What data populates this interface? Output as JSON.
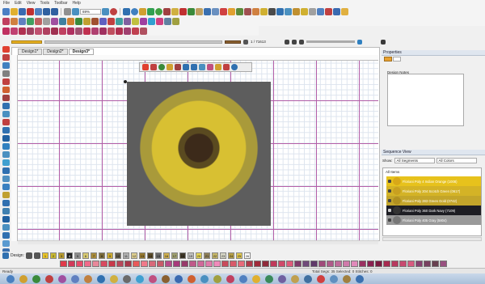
{
  "menu": [
    "File",
    "Edit",
    "View",
    "Tools",
    "Toolbar",
    "Help"
  ],
  "zoom": "69%",
  "stitch_position": "1 / 71613",
  "tabs": [
    "Design1*",
    "Design2*",
    "Design3*"
  ],
  "properties": {
    "title": "Properties",
    "notes_label": "Design Notes"
  },
  "sequence": {
    "title": "Sequence View",
    "show_label": "Show:",
    "segments": "All Segments",
    "colors": "All Colors",
    "all_items": "All Items",
    "items": [
      {
        "label": "Floriani Poly 4 Indian Orange (1008)",
        "color": "#e7c21c"
      },
      {
        "label": "Floriani Poly 204 Scotch Green (0617)",
        "color": "#d4b326"
      },
      {
        "label": "Floriani Poly 283 Green Gold (0742)",
        "color": "#c3a52a"
      },
      {
        "label": "Floriani Poly 360 Dark Navy (7109)",
        "color": "#1d1d23"
      },
      {
        "label": "Floriani Poly 405 Gray (5804)",
        "color": "#9a9a9a"
      }
    ]
  },
  "design_label": "Design:",
  "thread_swatches": [
    {
      "n": "1",
      "c": "#e8c328"
    },
    {
      "n": "2",
      "c": "#c8b832"
    },
    {
      "n": "3",
      "c": "#b89b2e"
    },
    {
      "n": "4",
      "c": "#222222"
    },
    {
      "n": "5",
      "c": "#8c8c8c"
    },
    {
      "n": "6",
      "c": "#d8ca72"
    },
    {
      "n": "7",
      "c": "#a88a3a"
    },
    {
      "n": "8",
      "c": "#7a6a3a"
    },
    {
      "n": "9",
      "c": "#c8a830"
    },
    {
      "n": "10",
      "c": "#605a4a"
    },
    {
      "n": "11",
      "c": "#b0b0b0"
    },
    {
      "n": "12",
      "c": "#e0d090"
    },
    {
      "n": "13",
      "c": "#987a30"
    },
    {
      "n": "14",
      "c": "#5a4a28"
    },
    {
      "n": "15",
      "c": "#6a6a6a"
    },
    {
      "n": "16",
      "c": "#d0b050"
    },
    {
      "n": "17",
      "c": "#a0a070"
    },
    {
      "n": "18",
      "c": "#403828"
    },
    {
      "n": "19",
      "c": "#c0c0c0"
    },
    {
      "n": "20",
      "c": "#e8d858"
    },
    {
      "n": "21",
      "c": "#908058"
    },
    {
      "n": "22",
      "c": "#c8b868"
    },
    {
      "n": "23",
      "c": "#d8d8c8"
    },
    {
      "n": "24",
      "c": "#b8a048"
    },
    {
      "n": "25",
      "c": "#e0c850"
    },
    {
      "n": "26",
      "c": "#ffffff"
    }
  ],
  "palette_colors": [
    "#e03a4a",
    "#d23a5a",
    "#e84a6a",
    "#f06a8a",
    "#e8889a",
    "#d84a60",
    "#c83a4a",
    "#b8485a",
    "#a8384a",
    "#e85a5a",
    "#f07a8a",
    "#d86a7a",
    "#c85a6a",
    "#b84a8a",
    "#a83a7a",
    "#983a6a",
    "#c05a8a",
    "#d06a9a",
    "#e07aaa",
    "#f08aba",
    "#c84a5a",
    "#d85a6a",
    "#e86a7a",
    "#b03a4a",
    "#a02a3a",
    "#902a3a",
    "#c03a5a",
    "#d04a6a",
    "#e05a7a",
    "#803a6a",
    "#704a7a",
    "#603a6a",
    "#a04a7a",
    "#b05a8a",
    "#c06a9a",
    "#d07aaa",
    "#e08aba",
    "#9a3060",
    "#8a2050",
    "#7a1a40",
    "#a82a50",
    "#b83a60",
    "#c84a70",
    "#d85a80",
    "#884070",
    "#784060",
    "#684050",
    "#985080"
  ],
  "status": {
    "left": "Ready",
    "right": "Total Segs: 35 Selected: 0 Stitches: 0"
  },
  "colors": {
    "grid_major": "#b45fa8",
    "panel_header": "#dfe6ef",
    "dock": "#b9cce3"
  }
}
